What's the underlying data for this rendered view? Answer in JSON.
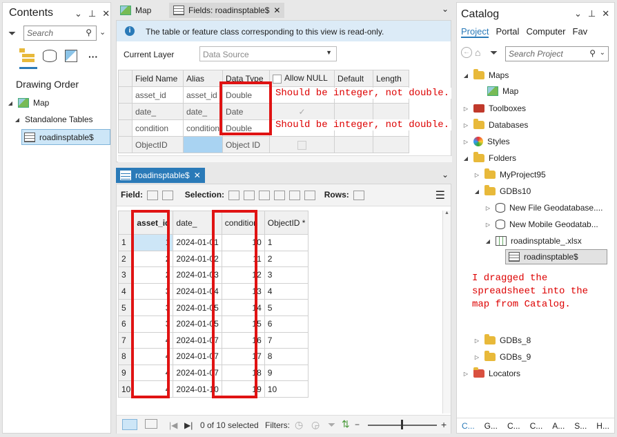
{
  "contents": {
    "title": "Contents",
    "search_placeholder": "Search",
    "drawing_order": "Drawing Order",
    "map_label": "Map",
    "standalone_tables": "Standalone Tables",
    "table_item": "roadinsptable$"
  },
  "fields_view": {
    "tabs": [
      {
        "label": "Map"
      },
      {
        "label": "Fields: roadinsptable$"
      }
    ],
    "info": "The table or feature class corresponding to this view is read-only.",
    "current_layer_label": "Current Layer",
    "current_layer_value": "Data Source",
    "headers": [
      "Field Name",
      "Alias",
      "Data Type",
      "Allow NULL",
      "Default",
      "Length"
    ],
    "rows": [
      {
        "name": "asset_id",
        "alias": "asset_id",
        "type": "Double"
      },
      {
        "name": "date_",
        "alias": "date_",
        "type": "Date"
      },
      {
        "name": "condition",
        "alias": "condition",
        "type": "Double"
      },
      {
        "name": "ObjectID",
        "alias": "",
        "type": "Object ID"
      }
    ],
    "note1": "Should be integer, not double.",
    "note2": "Should be integer, not double."
  },
  "table_view": {
    "tab_label": "roadinsptable$",
    "field_label": "Field:",
    "selection_label": "Selection:",
    "rows_label": "Rows:",
    "headers": [
      "asset_id",
      "date_",
      "condition",
      "ObjectID *"
    ],
    "rows": [
      {
        "n": "1",
        "asset_id": "1",
        "date": "2024-01-01",
        "condition": "10",
        "oid": "1"
      },
      {
        "n": "2",
        "asset_id": "2",
        "date": "2024-01-02",
        "condition": "11",
        "oid": "2"
      },
      {
        "n": "3",
        "asset_id": "2",
        "date": "2024-01-03",
        "condition": "12",
        "oid": "3"
      },
      {
        "n": "4",
        "asset_id": "3",
        "date": "2024-01-04",
        "condition": "13",
        "oid": "4"
      },
      {
        "n": "5",
        "asset_id": "3",
        "date": "2024-01-05",
        "condition": "14",
        "oid": "5"
      },
      {
        "n": "6",
        "asset_id": "3",
        "date": "2024-01-05",
        "condition": "15",
        "oid": "6"
      },
      {
        "n": "7",
        "asset_id": "4",
        "date": "2024-01-07",
        "condition": "16",
        "oid": "7"
      },
      {
        "n": "8",
        "asset_id": "4",
        "date": "2024-01-07",
        "condition": "17",
        "oid": "8"
      },
      {
        "n": "9",
        "asset_id": "4",
        "date": "2024-01-07",
        "condition": "18",
        "oid": "9"
      },
      {
        "n": "10",
        "asset_id": "4",
        "date": "2024-01-10",
        "condition": "19",
        "oid": "10"
      }
    ],
    "selected_text": "0 of 10 selected",
    "filters_label": "Filters:",
    "zoom_plus": "+"
  },
  "catalog": {
    "title": "Catalog",
    "tabs": [
      "Project",
      "Portal",
      "Computer",
      "Fav"
    ],
    "search_placeholder": "Search Project",
    "items": {
      "maps": "Maps",
      "map": "Map",
      "toolboxes": "Toolboxes",
      "databases": "Databases",
      "styles": "Styles",
      "folders": "Folders",
      "myproject": "MyProject95",
      "gdbs10": "GDBs10",
      "new_fgdb": "New File Geodatabase....",
      "new_mgdb": "New Mobile Geodatab...",
      "xlsx": "roadinsptable_.xlsx",
      "sheet": "roadinsptable$",
      "gdbs8": "GDBs_8",
      "gdbs9": "GDBs_9",
      "locators": "Locators"
    },
    "annotation": [
      "I dragged the",
      "spreadsheet into the",
      "map from Catalog."
    ],
    "bottom_tabs": [
      "C...",
      "G...",
      "C...",
      "C...",
      "A...",
      "S...",
      "H..."
    ]
  }
}
